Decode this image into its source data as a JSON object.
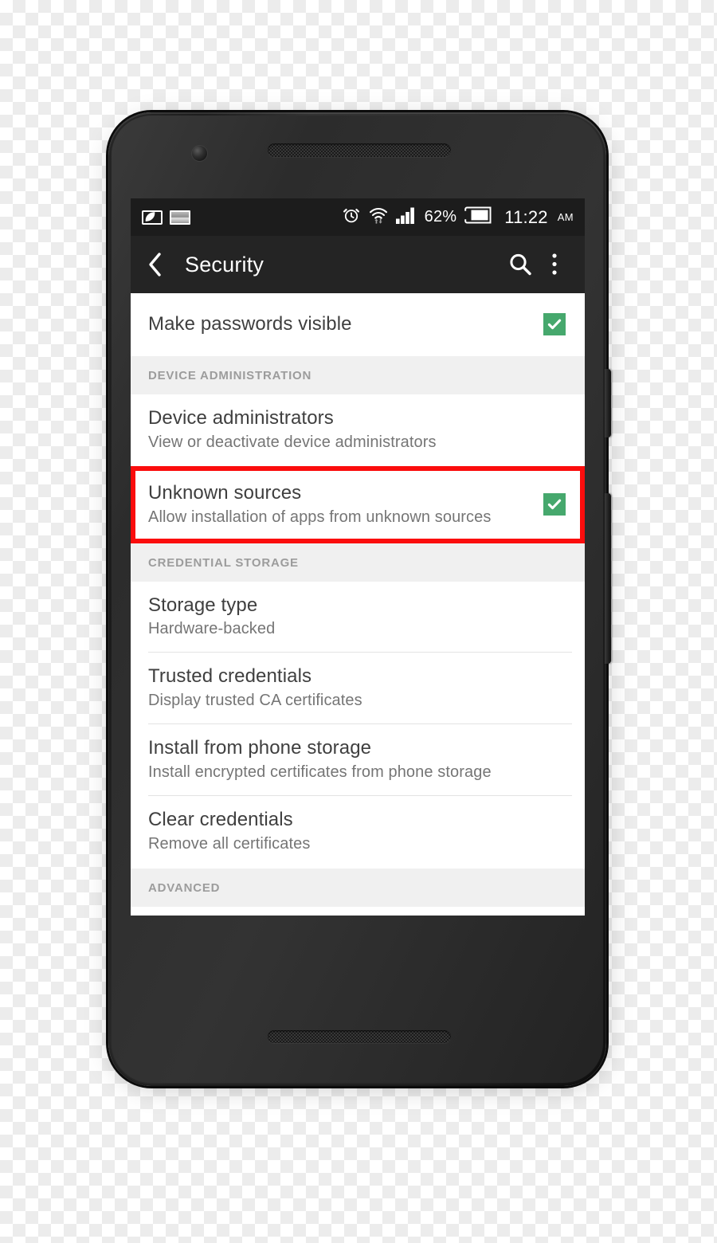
{
  "status_bar": {
    "notification_icons": [
      "power-saver-battery-icon",
      "screenshot-image-icon"
    ],
    "alarm_icon": "alarm-clock-icon",
    "wifi_icon": "wifi-data-transfer-icon",
    "signal_icon": "cellular-signal-icon",
    "battery_percent": "62%",
    "battery_icon": "battery-icon",
    "time": "11:22",
    "ampm": "AM"
  },
  "action_bar": {
    "back_icon": "back-chevron-icon",
    "title": "Security",
    "search_icon": "search-icon",
    "overflow_icon": "overflow-menu-icon"
  },
  "colors": {
    "accent_green": "#46a86d",
    "highlight_red": "#fb0d0d",
    "status_bar_bg": "#1c1c1c",
    "action_bar_bg": "#242424",
    "section_header_bg": "#f0f0f0",
    "title_text": "#3f3f3f",
    "subtitle_text": "#757575",
    "section_header_text": "#9c9c9c"
  },
  "list": {
    "top_row": {
      "title": "Make passwords visible",
      "checked": true
    },
    "sections": [
      {
        "header": "DEVICE ADMINISTRATION",
        "rows": [
          {
            "title": "Device administrators",
            "subtitle": "View or deactivate device administrators",
            "checkbox": false,
            "highlighted": false
          },
          {
            "title": "Unknown sources",
            "subtitle": "Allow installation of apps from unknown sources",
            "checkbox": true,
            "checked": true,
            "highlighted": true
          }
        ]
      },
      {
        "header": "CREDENTIAL STORAGE",
        "rows": [
          {
            "title": "Storage type",
            "subtitle": "Hardware-backed",
            "checkbox": false,
            "highlighted": false
          },
          {
            "title": "Trusted credentials",
            "subtitle": "Display trusted CA certificates",
            "checkbox": false,
            "highlighted": false
          },
          {
            "title": "Install from phone storage",
            "subtitle": "Install encrypted certificates from phone storage",
            "checkbox": false,
            "highlighted": false
          },
          {
            "title": "Clear credentials",
            "subtitle": "Remove all certificates",
            "checkbox": false,
            "highlighted": false
          }
        ]
      },
      {
        "header": "ADVANCED",
        "rows": []
      }
    ]
  },
  "device": {
    "front_camera": "front-camera",
    "earpiece": "earpiece-speaker-grille",
    "bottom_speaker": "bottom-speaker-grille",
    "power_button": "power-button",
    "volume_button": "volume-rocker-button"
  }
}
